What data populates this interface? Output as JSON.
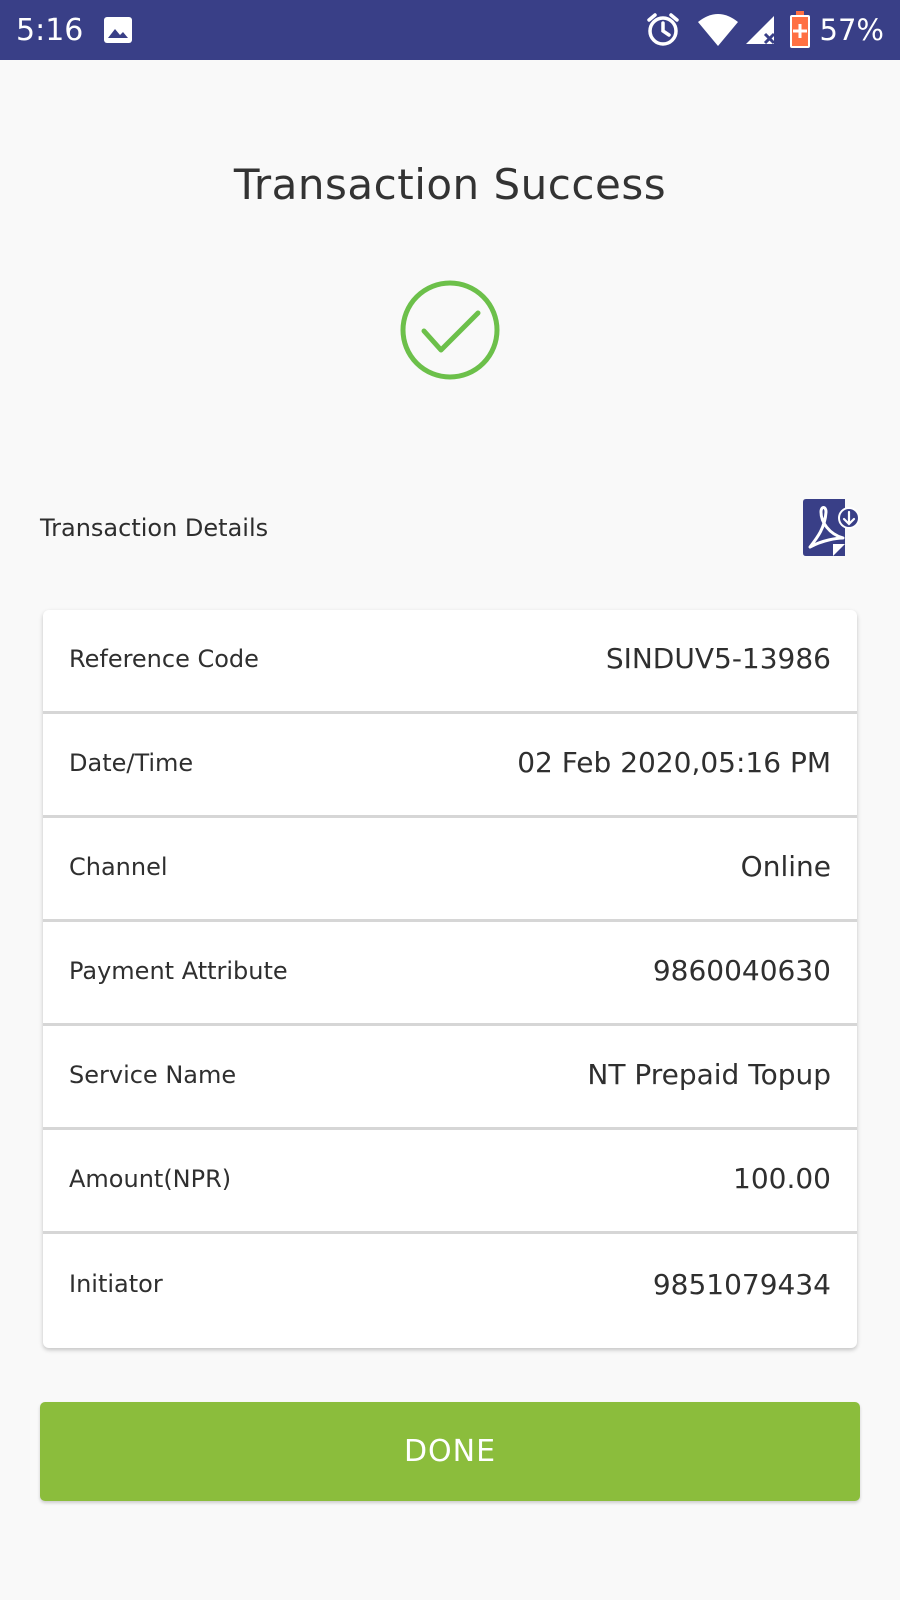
{
  "status_bar": {
    "time": "5:16",
    "battery_percent": "57%",
    "icons": [
      "image-icon",
      "alarm-icon",
      "wifi-icon",
      "cell-signal-icon",
      "battery-icon"
    ],
    "background_color": "#393f87"
  },
  "page": {
    "title": "Transaction Success",
    "success_icon": "check-circle-icon",
    "success_color": "#6cc04a"
  },
  "details": {
    "section_label": "Transaction Details",
    "download_icon": "pdf-download-icon",
    "rows": [
      {
        "label": "Reference Code",
        "value": "SINDUV5-13986"
      },
      {
        "label": "Date/Time",
        "value": "02 Feb 2020,05:16 PM"
      },
      {
        "label": "Channel",
        "value": "Online"
      },
      {
        "label": "Payment Attribute",
        "value": "9860040630"
      },
      {
        "label": "Service Name",
        "value": "NT Prepaid Topup"
      },
      {
        "label": "Amount(NPR)",
        "value": "100.00"
      },
      {
        "label": "Initiator",
        "value": "9851079434"
      }
    ]
  },
  "actions": {
    "done_label": "DONE",
    "done_color": "#8bbd3c"
  }
}
